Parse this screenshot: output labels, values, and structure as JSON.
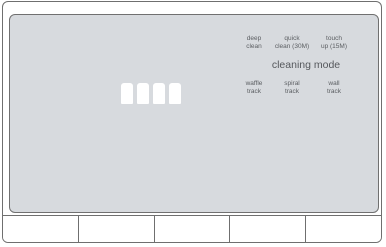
{
  "modes": {
    "title": "cleaning mode",
    "top_options": [
      {
        "label": "deep\nclean"
      },
      {
        "label": "quick\nclean (30M)"
      },
      {
        "label": "touch\nup (15M)"
      }
    ],
    "bottom_options": [
      {
        "label": "waffle\ntrack"
      },
      {
        "label": "spiral\ntrack"
      },
      {
        "label": "wall\ntrack"
      }
    ]
  },
  "battery": {
    "cells_total": 4,
    "cells_filled": 4
  },
  "colors": {
    "screen_background": "#d7dade",
    "text": "#5b5e62",
    "battery_cell": "#ffffff"
  }
}
